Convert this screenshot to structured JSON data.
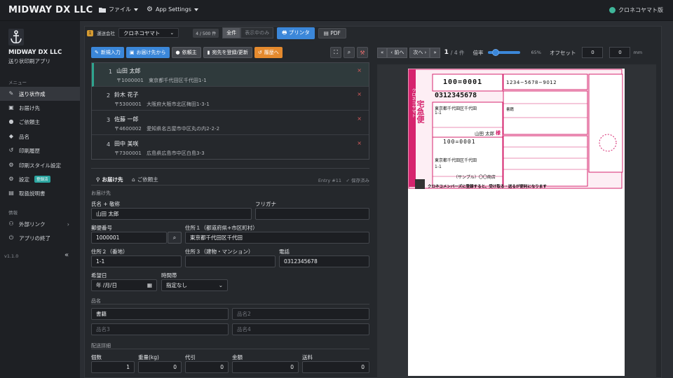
{
  "topbar": {
    "brand": "MIDWAY DX LLC",
    "file_menu": "ファイル",
    "settings_menu": "App Settings",
    "carrier_status": "クロネコヤマト版"
  },
  "sidebar": {
    "app_name": "MIDWAY DX LLC",
    "app_sub": "送り状印刷アプリ",
    "section_menu": "メニュー",
    "items": [
      {
        "label": "送り状作成",
        "icon": "edit-icon"
      },
      {
        "label": "お届け先",
        "icon": "person-icon"
      },
      {
        "label": "ご依頼主",
        "icon": "user-icon"
      },
      {
        "label": "品名",
        "icon": "tag-icon"
      },
      {
        "label": "印刷履歴",
        "icon": "history-icon"
      },
      {
        "label": "印刷スタイル設定",
        "icon": "printer-settings-icon"
      },
      {
        "label": "設定",
        "icon": "gear-icon",
        "badge": "登録済"
      },
      {
        "label": "取扱説明書",
        "icon": "book-icon"
      }
    ],
    "section_info": "情報",
    "info_items": [
      {
        "label": "外部リンク",
        "icon": "link-icon"
      },
      {
        "label": "アプリの終了",
        "icon": "power-icon"
      }
    ],
    "version": "v1.1.0"
  },
  "toolbar": {
    "step": "1",
    "carrier_label": "運送会社",
    "carrier_value": "クロネコヤマト",
    "count": "4 / 500 件",
    "seg_all": "全件",
    "seg_current": "表示中のみ",
    "print": "プリンタ",
    "pdf": "PDF"
  },
  "actions": {
    "new_insert": "新規入力",
    "from_address": "お届け先から",
    "requester": "依頼主",
    "save_address": "宛先を登録/更新",
    "history": "履歴へ"
  },
  "addresses": [
    {
      "idx": "1",
      "name": "山田 太郎",
      "line": "〒1000001　東京都千代田区千代田1-1"
    },
    {
      "idx": "2",
      "name": "鈴木 花子",
      "line": "〒5300001　大阪府大阪市北区梅田1-3-1"
    },
    {
      "idx": "3",
      "name": "佐藤 一郎",
      "line": "〒4600002　愛知県名古屋市中区丸の内2-2-2"
    },
    {
      "idx": "4",
      "name": "田中 美咲",
      "line": "〒7300001　広島県広島市中区白島3-3"
    }
  ],
  "form": {
    "tab_recipient": "お届け先",
    "tab_requester": "ご依頼主",
    "entry_info": "Entry #11",
    "saved": "保存済み",
    "section_recipient": "お届け先",
    "name_label": "氏名 + 敬称",
    "name_value": "山田 太郎",
    "furigana_label": "フリガナ",
    "postal_label": "郵便番号",
    "postal_value": "1000001",
    "addr1_label": "住所１（都道府県+市区町村）",
    "addr1_value": "東京都千代田区千代田",
    "addr2_label": "住所２（番地）",
    "addr2_value": "1-1",
    "addr3_label": "住所３（建物・マンション）",
    "phone_label": "電話",
    "phone_value": "0312345678",
    "date_label": "希望日",
    "date_value": "年 /月/日",
    "time_label": "時間帯",
    "time_value": "指定なし",
    "section_items": "品名",
    "item1": "書籍",
    "item2_ph": "品名2",
    "item3_ph": "品名3",
    "item4_ph": "品名4",
    "section_ship": "配送詳細",
    "qty_label": "個数",
    "qty_value": "1",
    "weight_label": "重量(kg)",
    "weight_value": "0",
    "cod_label": "代引",
    "cod_value": "0",
    "amount_label": "金額",
    "amount_value": "0",
    "fee_label": "送料",
    "fee_value": "0"
  },
  "preview": {
    "first": "«",
    "prev": "‹ 前へ",
    "next": "次へ ›",
    "last": "»",
    "page": "1",
    "total": "/ 4 件",
    "zoom_label": "倍率",
    "zoom_value": "65%",
    "zoom_level": 0.65,
    "offset_label": "オフセット",
    "offset_x": "0",
    "offset_y": "0",
    "unit": "mm"
  },
  "label": {
    "tracking": "1234−5678−9012",
    "to_postal": "100=0001",
    "to_phone": "0312345678",
    "to_addr1": "東京都千代田区千代田",
    "to_addr2": "1-1",
    "to_name": "山田 太郎",
    "honorific": "様",
    "from_postal": "100=0001",
    "from_addr1": "東京都千代田区千代田",
    "from_addr2": "1-1",
    "from_name": "（サンプル）〇〇商店",
    "item": "書籍",
    "side_text": "宅急便",
    "footer": "クロネコメンバーズに登録すると、受け取る・送るが便利になります"
  }
}
